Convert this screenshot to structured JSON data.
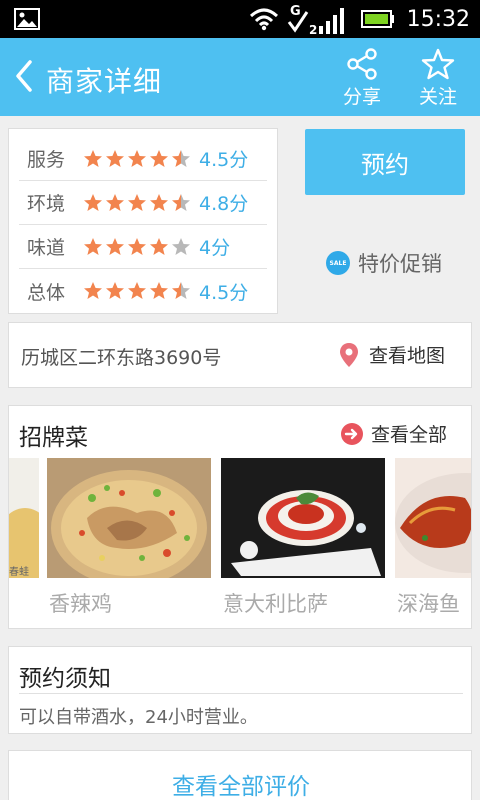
{
  "status_bar": {
    "time": "15:32",
    "signal_letter": "G",
    "signal_sub": "2"
  },
  "header": {
    "title": "商家详细",
    "share_label": "分享",
    "follow_label": "关注"
  },
  "ratings": [
    {
      "label": "服务",
      "score_text": "4.5分",
      "stars": 4.5
    },
    {
      "label": "环境",
      "score_text": "4.8分",
      "stars": 4.5
    },
    {
      "label": "味道",
      "score_text": "4分",
      "stars": 4
    },
    {
      "label": "总体",
      "score_text": "4.5分",
      "stars": 4.5
    }
  ],
  "book_button": "预约",
  "promo": {
    "badge": "SALE",
    "label": "特价促销"
  },
  "address": {
    "text": "历城区二环东路3690号",
    "map_link": "查看地图"
  },
  "dishes": {
    "title": "招牌菜",
    "see_all": "查看全部",
    "partial_left_caption": "春蛙",
    "items": [
      {
        "name": "香辣鸡"
      },
      {
        "name": "意大利比萨"
      },
      {
        "name": "深海鱼"
      }
    ]
  },
  "notice": {
    "title": "预约须知",
    "text": "可以自带酒水，24小时营业。"
  },
  "reviews_link": "查看全部评价",
  "colors": {
    "accent": "#4ec0f1",
    "score": "#3eaee6",
    "star": "#f2844e",
    "star_empty": "#b8b8b8"
  }
}
